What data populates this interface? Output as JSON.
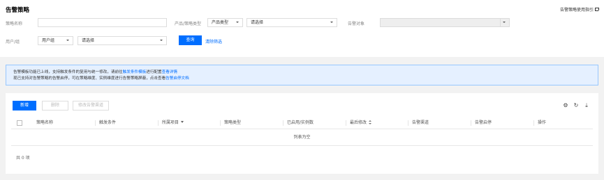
{
  "header": {
    "title": "告警策略",
    "guide_link": "告警策略使用指引"
  },
  "filters": {
    "policy_name_label": "策略名称",
    "policy_name_value": "",
    "product_type_label": "产品/策略类型",
    "product_type_value": "产品类型",
    "policy_type_value": "请选择",
    "alarm_object_label": "告警对象",
    "alarm_object_value": "",
    "user_group_label": "用户/组",
    "user_group_value": "用户组",
    "user_value": "请选择",
    "query_button": "查询",
    "clear_filter": "清除筛选"
  },
  "notice": {
    "line1_prefix": "告警模板功能已上线，支持触发条件的复用与统一修改，请前往",
    "line1_link1": "触发条件模板",
    "line1_middle": "进行配置",
    "line1_link2": "查看详情",
    "line2_prefix": "现已支持对告警策略的告警启停，可在策略维度、实例维度进行告警策略屏蔽，点击查看",
    "line2_link": "告警启停文档"
  },
  "toolbar": {
    "new_button": "新增",
    "delete_button": "删除",
    "modify_channel_button": "修改告警渠道"
  },
  "table": {
    "columns": [
      "策略名称",
      "触发条件",
      "所属项目",
      "策略类型",
      "已启用/实例数",
      "最后修改",
      "告警渠道",
      "告警启停",
      "操作"
    ],
    "empty_text": "列表为空",
    "total": "共 0 项"
  }
}
